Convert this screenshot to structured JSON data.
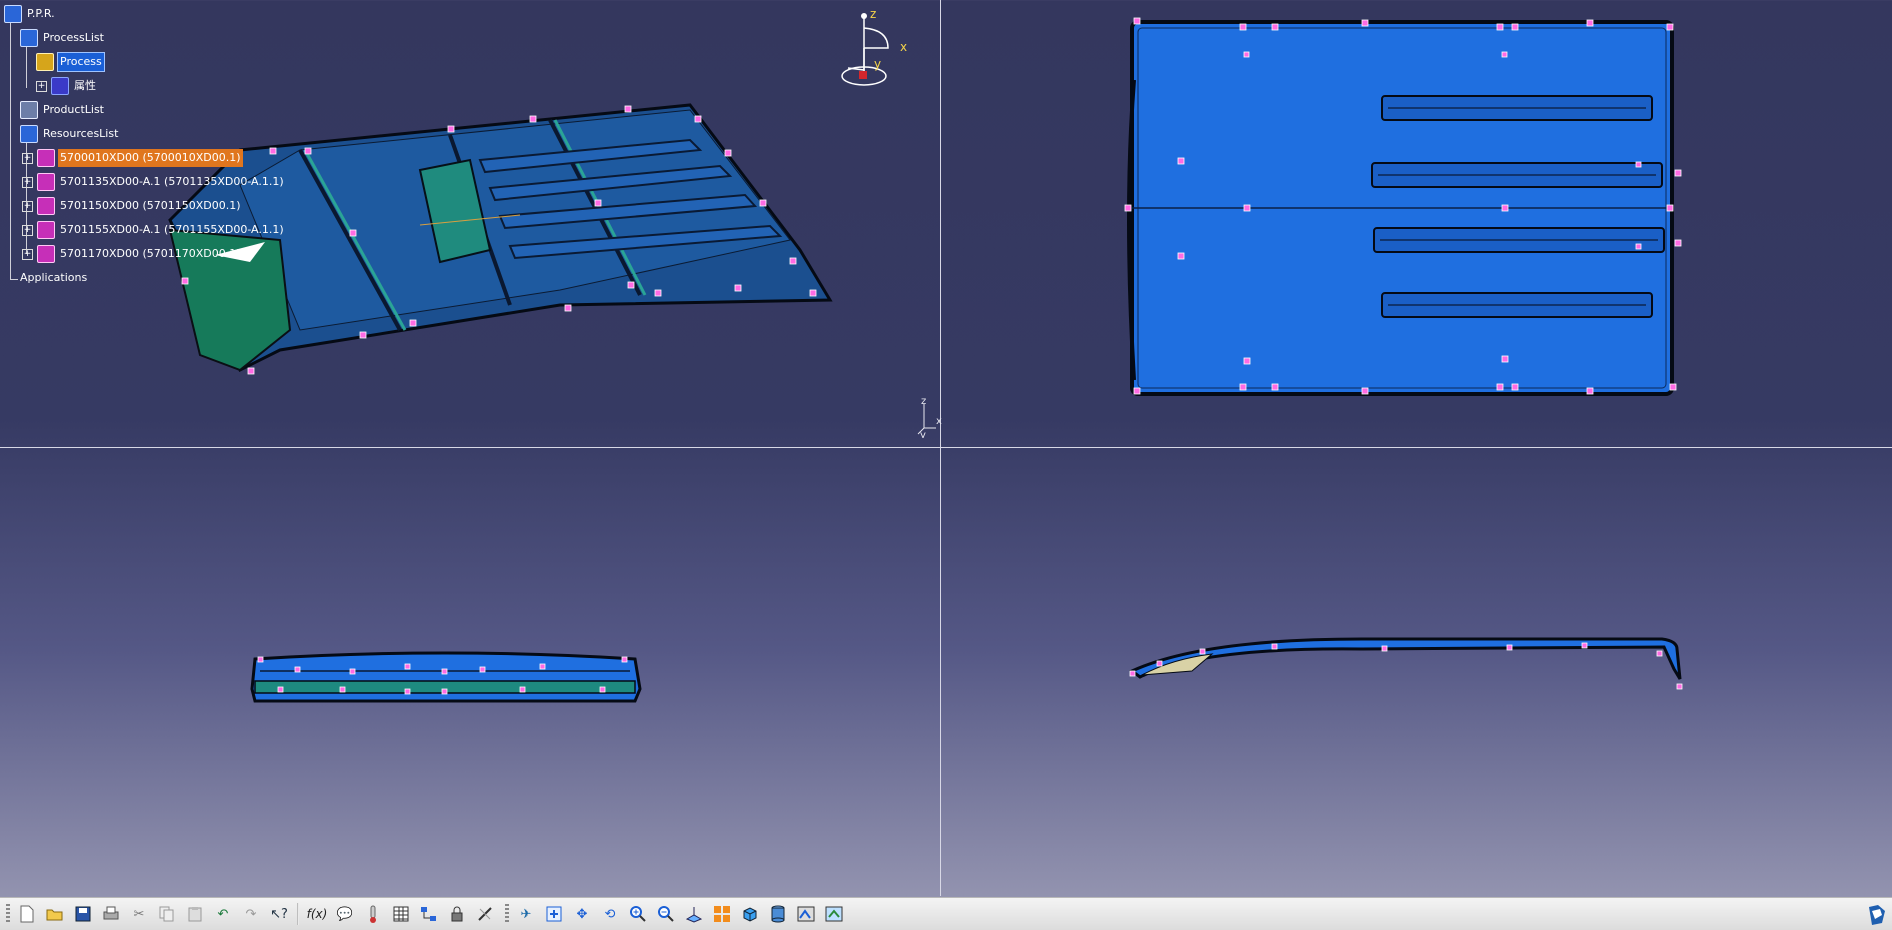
{
  "spec_tree": {
    "root": "P.P.R.",
    "process_list": "ProcessList",
    "process": "Process",
    "property": "属性",
    "product_list": "ProductList",
    "resources_list": "ResourcesList",
    "resources": [
      "5700010XD00 (5700010XD00.1)",
      "5701135XD00-A.1 (5701135XD00-A.1.1)",
      "5701150XD00 (5701150XD00.1)",
      "5701155XD00-A.1 (5701155XD00-A.1.1)",
      "5701170XD00 (5701170XD00.1)"
    ],
    "applications": "Applications"
  },
  "compass": {
    "z": "z",
    "x": "x",
    "y": "y"
  },
  "mini_axes": {
    "z": "z",
    "x": "x",
    "y": "y"
  },
  "toolbar_icons": [
    "new-icon",
    "open-icon",
    "save-icon",
    "print-icon",
    "cut-icon",
    "copy-icon",
    "paste-icon",
    "undo-icon",
    "redo-icon",
    "whats-this-icon",
    "formula-icon",
    "knowledge-icon",
    "thermometer-icon",
    "table-icon",
    "tree-expand-icon",
    "lock-icon",
    "measure-icon",
    "fly-mode-icon",
    "fit-all-icon",
    "pan-icon",
    "rotate-icon",
    "zoom-in-icon",
    "zoom-out-icon",
    "normal-view-icon",
    "quick-view-icon",
    "iso-view-icon",
    "visual-mode-icon",
    "hide-show-icon",
    "swap-visible-icon"
  ],
  "colors": {
    "background_top": "#34375e",
    "background_bottom": "#9b9bb5",
    "part_blue": "#1f6fe0",
    "part_dark": "#0d3c7a",
    "part_teal": "#1e8a80",
    "pin_magenta": "#ff5fe0",
    "selection": "#1a5fd6",
    "highlight": "#e0761e"
  }
}
